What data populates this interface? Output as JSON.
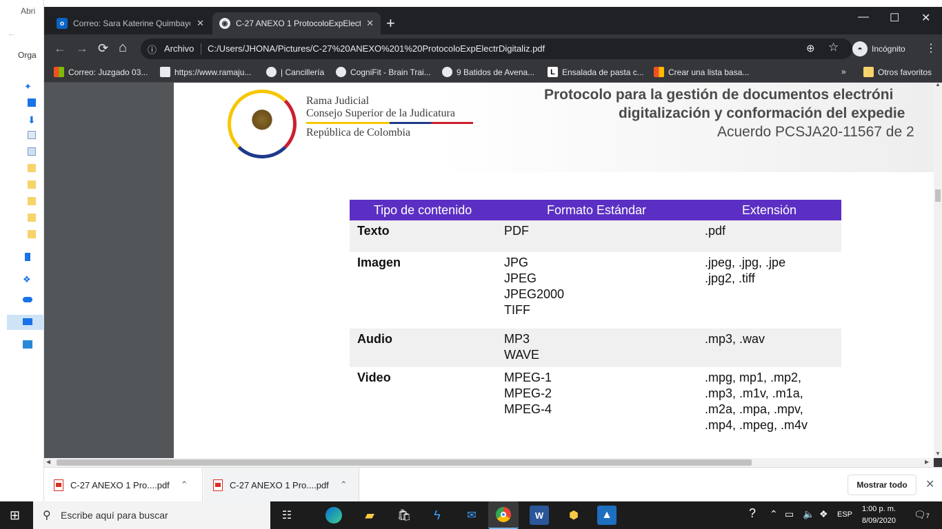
{
  "explorer": {
    "title_fragment": "Abri",
    "org_label": "Orga"
  },
  "tabs": [
    {
      "title": "Correo: Sara Katerine Quimbayo",
      "active": false,
      "favicon": "outlook-icon"
    },
    {
      "title": "C-27 ANEXO 1 ProtocoloExpElect",
      "active": true,
      "favicon": "globe-icon"
    }
  ],
  "new_tab_symbol": "+",
  "window_controls": {
    "minimize": "—",
    "maximize": "☐",
    "close": "✕"
  },
  "toolbar": {
    "back": "←",
    "forward": "→",
    "reload": "⟳",
    "home": "⌂",
    "mode_label": "Archivo",
    "url": "C:/Users/JHONA/Pictures/C-27%20ANEXO%201%20ProtocoloExpElectrDigitaliz.pdf",
    "incognito_label": "Incógnito",
    "menu": "⋮"
  },
  "bookmarks": [
    {
      "label": "Correo: Juzgado 03...",
      "color": "#f25022"
    },
    {
      "label": "https://www.ramaju...",
      "color": "#ffffff"
    },
    {
      "label": "| Cancillería",
      "color": "#9aa0a6"
    },
    {
      "label": "CogniFit - Brain Trai...",
      "color": "#9aa0a6"
    },
    {
      "label": "9 Batidos de Avena...",
      "color": "#9aa0a6"
    },
    {
      "label": "Ensalada de pasta c...",
      "color": "#ffffff"
    },
    {
      "label": "Crear una lista basa...",
      "color": "#f25022"
    }
  ],
  "bookmarks_overflow": "»",
  "other_favorites": "Otros favoritos",
  "pdf": {
    "header": {
      "org_line1": "Rama Judicial",
      "org_line2": "Consejo Superior de la Judicatura",
      "org_line3": "República de Colombia",
      "title_line1": "Protocolo para la gestión de documentos electróni",
      "title_line2": "digitalización y conformación del expedie",
      "title_line3": "Acuerdo PCSJA20-11567 de 2"
    },
    "table": {
      "headers": [
        "Tipo de contenido",
        "Formato Estándar",
        "Extensión"
      ],
      "rows": [
        {
          "type": "Texto",
          "formats": "PDF",
          "extensions": ".pdf",
          "shaded": true
        },
        {
          "type": "Imagen",
          "formats": "JPG\nJPEG\nJPEG2000\nTIFF",
          "extensions": ".jpeg, .jpg, .jpe\n.jpg2, .tiff",
          "shaded": false
        },
        {
          "type": "Audio",
          "formats": "MP3\nWAVE",
          "extensions": ".mp3, .wav",
          "shaded": true
        },
        {
          "type": "Video",
          "formats": "MPEG-1\nMPEG-2\nMPEG-4",
          "extensions": ".mpg, mp1, .mp2,\n.mp3, .m1v, .m1a,\n.m2a, .mpa, .mpv,\n.mp4, .mpeg, .m4v",
          "shaded": false
        }
      ]
    }
  },
  "downloads": [
    {
      "name": "C-27 ANEXO 1 Pro....pdf"
    },
    {
      "name": "C-27 ANEXO 1 Pro....pdf"
    }
  ],
  "downloads_show_all": "Mostrar todo",
  "taskbar": {
    "search_placeholder": "Escribe aquí para buscar",
    "language": "ESP",
    "time": "1:00 p. m.",
    "date": "8/09/2020",
    "notifications_count": "7"
  }
}
